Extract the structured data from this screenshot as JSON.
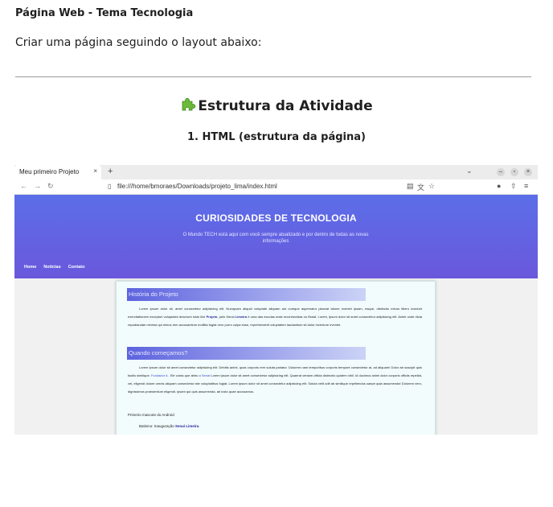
{
  "document": {
    "title": "Página Web - Tema Tecnologia",
    "intro": "Criar uma página seguindo o layout abaixo:",
    "section_heading": "Estrutura da Atividade",
    "section_icon": "puzzle-piece-icon",
    "sub_heading": "1. HTML (estrutura da página)"
  },
  "browser": {
    "tab_title": "Meu primeiro Projeto",
    "tab_close": "×",
    "new_tab": "+",
    "url": "file:///home/bmoraes/Downloads/projeto_lima/index.html"
  },
  "site": {
    "title": "CURIOSIDADES DE TECNOLOGIA",
    "subtitle": "O Mundo TECH está aqui com você sempre atualizado e por dentro de todas as novas informações",
    "nav": [
      "Home",
      "Notícias",
      "Contato"
    ],
    "heading1": "História do Projeto",
    "p1_a": "Lorem ipsum dolor sit, amet consectetur adipisicing elit. Numquam aliquid voluptate aliquam aut cumque aspernatur placeat labore eveniet ipsam, eaque, distinctio minus libero incidunt exercitationem excepturi voluptates deserunt iusto illo!",
    "p1_bold1": "Projeto",
    "p1_b": ", pelo Senai",
    "p1_bold2": "Limeira",
    "p1_c": "é uma das escolas mais reconhecidas no Brasil. Lorem, ipsum dolor sit amet consectetur adipisicing elit. Animi unde dicta repudiandae minima qui minus rem accusantium mollitia fugiat vero porro culpa esse, reprehenderit voluptatem laudantium sit dolor inventore eveniet.",
    "heading2": "Quando começamos?",
    "p2_a": "Lorem ipsum dolor sit amet consectetur adipisicing elit. Debitis animi, quas corporis rem soluta pariatur. Dolorem nam temporibus corporis tempore consectetur at, ad aliquam! Dolor ab suscipit quis facilis similique.",
    "p2_link1": "Fundador A",
    "p2_b": ". Ele conta que abriu o",
    "p2_link2": "Senai",
    "p2_c": "Lorem ipsum dolor sit amet consectetur adipisicing elit. Quaerat veniam officia distinctio quidem nihil. Id ducimus animi dolor corporis officiis repellat, vel, eligendi dolore omnis aliquam consectetur iste voluptatibus fugiat. Lorem ipsum dolor sit amet consectetur adipisicing elit. Soluta velit odit ab similique repellendus saepe quia assumenda! Dolorem vero, dignissimos praesentium eligendi, ipsam qui quis assumenda, ab iusto quae accusamus.",
    "line1": "Primeiro mascote do Android",
    "line2_prefix": "Batismo: Inauguração",
    "line2_bold": "Senai Limeira",
    "line2_suffix": "."
  }
}
